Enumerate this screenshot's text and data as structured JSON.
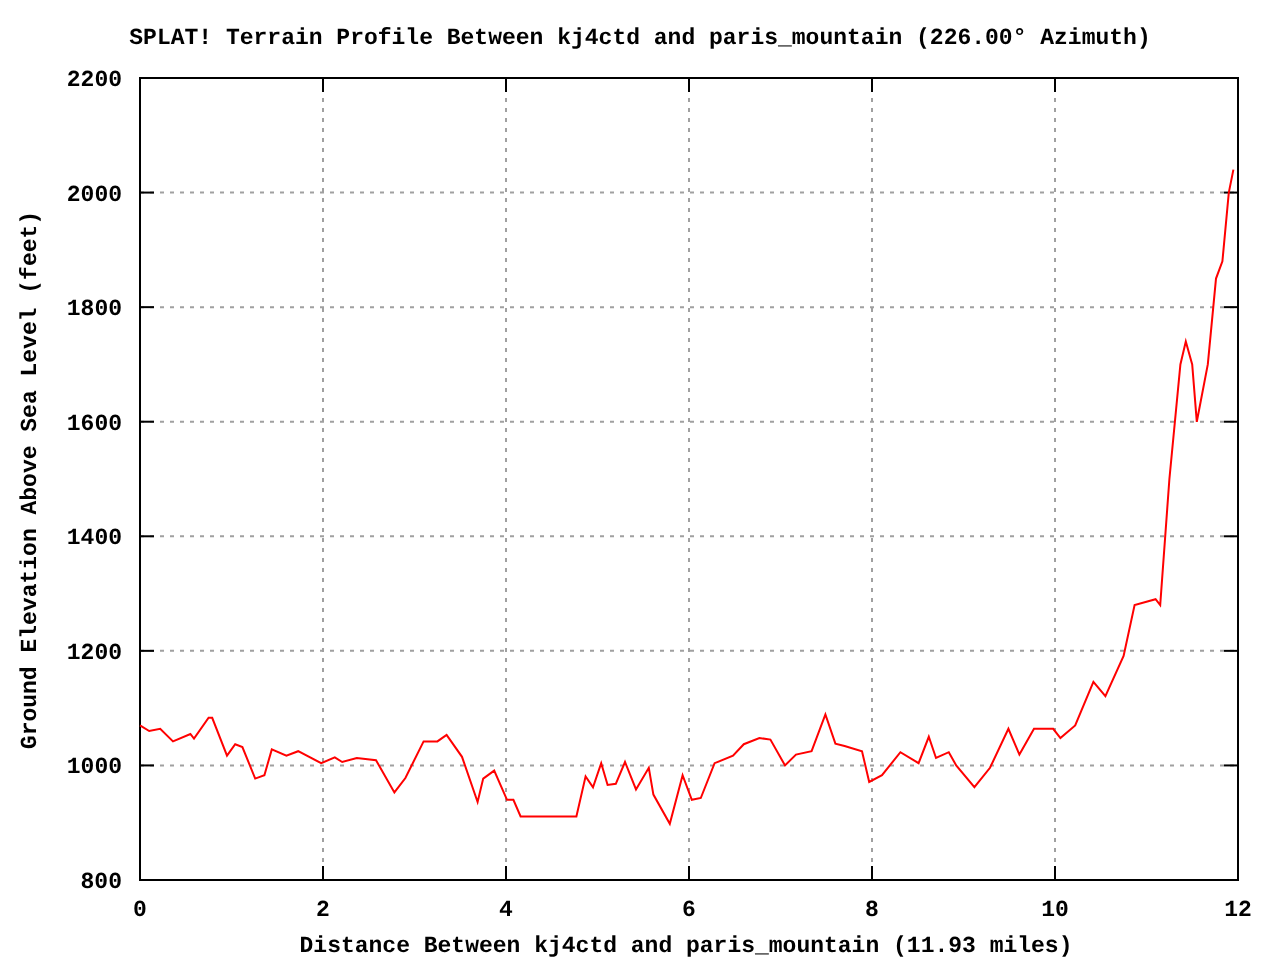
{
  "chart_data": {
    "type": "line",
    "title": "SPLAT! Terrain Profile Between kj4ctd and paris_mountain (226.00° Azimuth)",
    "xlabel": "Distance Between kj4ctd and paris_mountain (11.93 miles)",
    "ylabel": "Ground Elevation Above Sea Level (feet)",
    "xlim": [
      0,
      12
    ],
    "ylim": [
      800,
      2200
    ],
    "xticks": [
      0,
      2,
      4,
      6,
      8,
      10,
      12
    ],
    "yticks": [
      800,
      1000,
      1200,
      1400,
      1600,
      1800,
      2000,
      2200
    ],
    "grid": true,
    "x": [
      0,
      0.1,
      0.22,
      0.36,
      0.55,
      0.59,
      0.75,
      0.79,
      0.95,
      1.04,
      1.12,
      1.26,
      1.36,
      1.44,
      1.6,
      1.73,
      1.98,
      2.13,
      2.21,
      2.37,
      2.58,
      2.78,
      2.9,
      3.1,
      3.25,
      3.35,
      3.52,
      3.69,
      3.75,
      3.87,
      4.01,
      4.08,
      4.16,
      4.77,
      4.87,
      4.95,
      5.04,
      5.11,
      5.2,
      5.3,
      5.42,
      5.56,
      5.61,
      5.79,
      5.93,
      6.03,
      6.13,
      6.28,
      6.48,
      6.6,
      6.77,
      6.89,
      7.05,
      7.17,
      7.34,
      7.49,
      7.6,
      7.7,
      7.89,
      7.97,
      8.11,
      8.31,
      8.51,
      8.62,
      8.7,
      8.84,
      8.92,
      9.12,
      9.29,
      9.49,
      9.61,
      9.77,
      9.98,
      10.06,
      10.22,
      10.42,
      10.55,
      10.75,
      10.87,
      11.1,
      11.15,
      11.25,
      11.37,
      11.43,
      11.5,
      11.55,
      11.67,
      11.76,
      11.83,
      11.9,
      11.95
    ],
    "series": [
      {
        "color": "#ff0000",
        "values": [
          1070,
          1060,
          1064,
          1042,
          1055,
          1047,
          1083,
          1083,
          1017,
          1037,
          1032,
          977,
          983,
          1028,
          1017,
          1025,
          1004,
          1014,
          1006,
          1013,
          1009,
          953,
          978,
          1042,
          1042,
          1053,
          1015,
          936,
          977,
          991,
          940,
          940,
          911,
          911,
          981,
          962,
          1004,
          966,
          968,
          1006,
          958,
          996,
          949,
          898,
          983,
          940,
          943,
          1004,
          1017,
          1037,
          1048,
          1045,
          1000,
          1019,
          1025,
          1089,
          1038,
          1034,
          1025,
          971,
          983,
          1023,
          1004,
          1050,
          1013,
          1023,
          1000,
          962,
          996,
          1064,
          1019,
          1064,
          1064,
          1048,
          1070,
          1146,
          1121,
          1191,
          1280,
          1290,
          1280,
          1500,
          1700,
          1740,
          1700,
          1600,
          1700,
          1850,
          1880,
          2000,
          2040
        ]
      }
    ]
  }
}
